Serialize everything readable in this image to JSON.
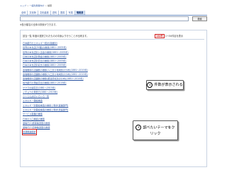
{
  "breadcrumb": [
    "トップ",
    "一般利用者向け",
    "検索"
  ],
  "tabs": [
    {
      "label": "全体",
      "active": false
    },
    {
      "label": "文化財",
      "active": false
    },
    {
      "label": "文化遺産",
      "active": false
    },
    {
      "label": "史料",
      "active": false
    },
    {
      "label": "図書",
      "active": false
    },
    {
      "label": "写真",
      "active": false
    },
    {
      "label": "情報源",
      "active": true
    }
  ],
  "search": {
    "value": "",
    "button_label": "検索"
  },
  "note": "※各分類名の全体の検索ができます。",
  "results": {
    "summary": "該当一覧 年度の選択されたものの中身より行うことが出来ます。",
    "count": "144件",
    "range": "1〜50件目を表示",
    "items": [
      "日本銀行のエネルギー統計(産業別)",
      "世界の本支店(50国)の推移(1881〜2005年)",
      "世界の本支店別入出金の推移(1881〜2005年)",
      "日本の本支店別預金の推移(1881〜2005年)",
      "日本の本支店別貸出の推移(1881〜2005年)",
      "日本の本支店別収支の推移(1881〜2005年)",
      "金融機関の店舗数の推移(人口及び地域別の分布)(1881〜2015年)",
      "金融機関の店舗数の推移(人口及び地域別の分布)(1881〜2015年)",
      "金融機関の店舗数の推移(都道府県別の分布)(1881〜2015年)",
      "地方銀行の預金貸出の推移(1881〜2015年)",
      "サクラの開花日(1881〜2015年)",
      "イチョウの黄葉日(1881〜2015年)",
      "さくらんぼのいろいろ一覧",
      "エネルギー需給構造",
      "エネルギー別需給構造の推移と現状(産業部門)",
      "エネルギー別需給構造の推移と現状(家庭部門)",
      "サービス産業の推移",
      "日本の人口構造の推移",
      "運輸行(1)旅客輸送量の推移",
      "運輸行(2)貨物輸送量の推移",
      "交通関連統計"
    ],
    "selected_index": 20
  },
  "callouts": [
    {
      "number": "①",
      "text": "件数が表示される"
    },
    {
      "number": "②",
      "line1": "調べたいテーマをク",
      "line2": "リック"
    }
  ],
  "colors": {
    "link": "#2a53a0",
    "highlight": "#d22222",
    "tab_active_bg": "#dbe6f6"
  }
}
